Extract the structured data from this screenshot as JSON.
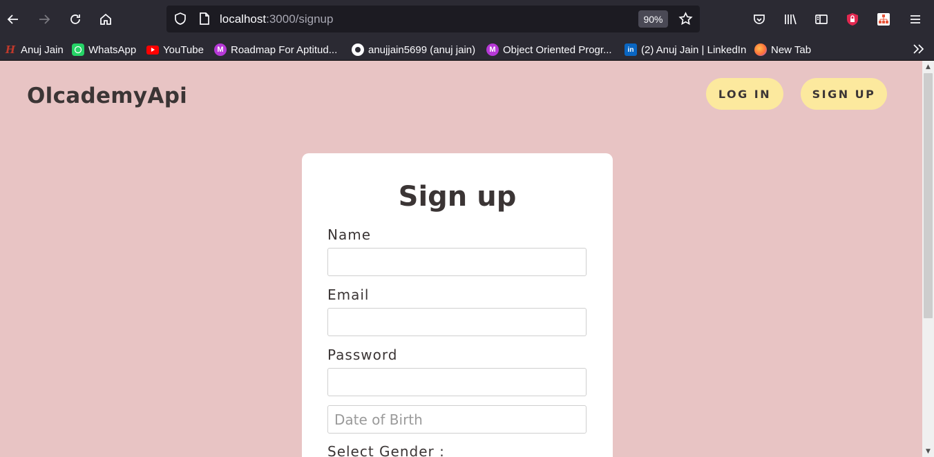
{
  "browser": {
    "url_host": "localhost",
    "url_path": ":3000/signup",
    "zoom": "90%"
  },
  "bookmarks": [
    {
      "label": "Anuj Jain",
      "icon": "hackerrank-h-icon",
      "color": "#c0392b"
    },
    {
      "label": "WhatsApp",
      "icon": "whatsapp-icon",
      "color": "#25d366"
    },
    {
      "label": "YouTube",
      "icon": "youtube-icon",
      "color": "#ff0000"
    },
    {
      "label": "Roadmap For Aptitud...",
      "icon": "m-icon",
      "color": "#b638d6"
    },
    {
      "label": "anujjain5699 (anuj jain)",
      "icon": "github-icon",
      "color": "#fbfbfe"
    },
    {
      "label": "Object Oriented Progr...",
      "icon": "m-icon",
      "color": "#b638d6"
    },
    {
      "label": "(2) Anuj Jain | LinkedIn",
      "icon": "linkedin-icon",
      "color": "#0a66c2"
    },
    {
      "label": "New Tab",
      "icon": "firefox-icon",
      "color": "#ff7139"
    }
  ],
  "page": {
    "brand": "OlcademyApi",
    "login_label": "LOG IN",
    "signup_label": "SIGN UP",
    "form": {
      "title": "Sign up",
      "name_label": "Name",
      "email_label": "Email",
      "password_label": "Password",
      "dob_placeholder": "Date of Birth",
      "gender_label": "Select Gender :"
    }
  },
  "colors": {
    "page_bg": "#e8c4c4",
    "button_bg": "#fce99e",
    "text": "#3b3535"
  }
}
